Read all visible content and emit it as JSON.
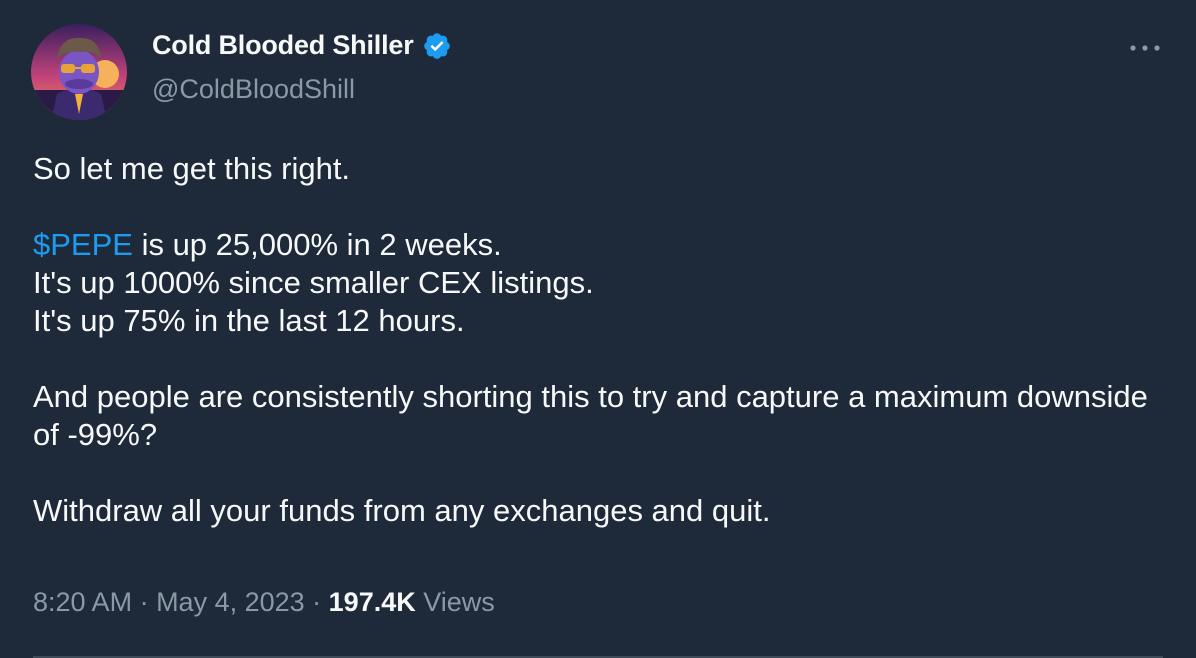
{
  "author": {
    "display_name": "Cold Blooded Shiller",
    "handle": "@ColdBloodShill",
    "verified": true,
    "avatar_icon": "avatar-icon"
  },
  "more_icon": "more-options-icon",
  "tweet": {
    "line1": "So let me get this right.",
    "cashtag": "$PEPE",
    "line2_rest": " is up 25,000% in 2 weeks.",
    "line3": "It's up 1000% since smaller CEX listings.",
    "line4": "It's up 75% in the last 12 hours.",
    "line5": "And people are consistently shorting this to try and capture a maximum downside of -99%?",
    "line6": "Withdraw all your funds from any exchanges and quit."
  },
  "meta": {
    "time": "8:20 AM",
    "sep1": " · ",
    "date": "May 4, 2023",
    "sep2": " · ",
    "views_count": "197.4K",
    "views_label": " Views"
  },
  "colors": {
    "background": "#1e2a3a",
    "text": "#f7f9f9",
    "secondary": "#8b98a5",
    "accent": "#1d9bf0"
  }
}
